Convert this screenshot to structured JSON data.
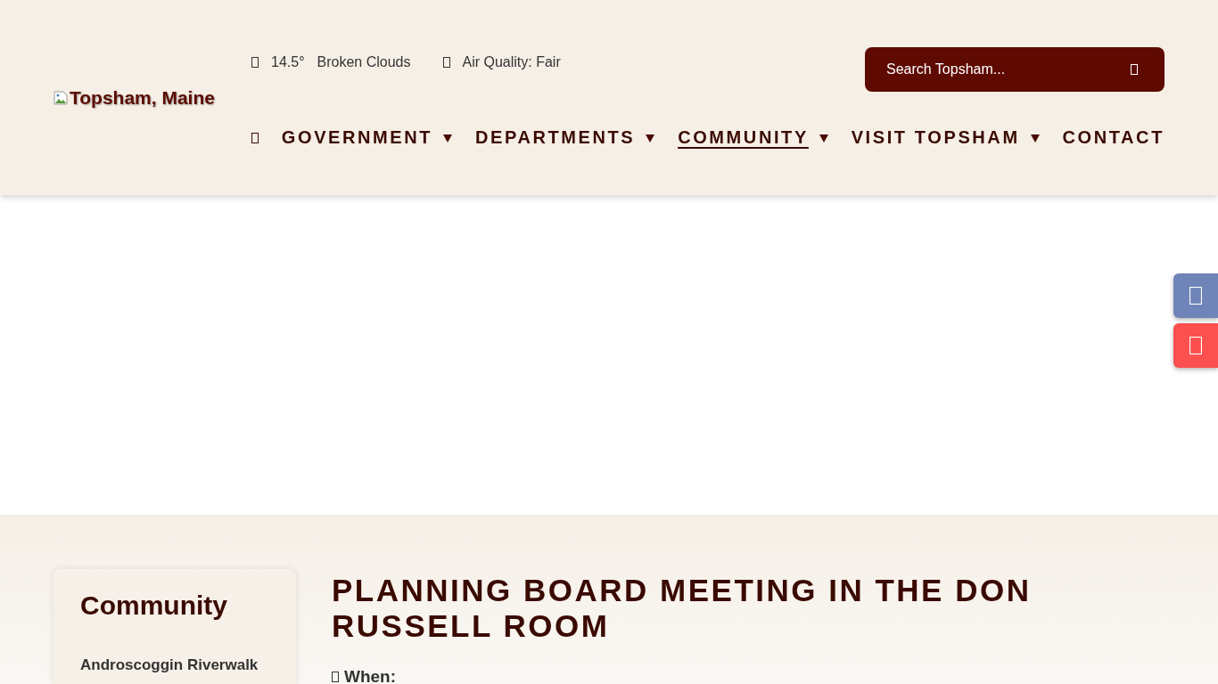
{
  "header": {
    "logo": {
      "alt_text": "Topsham, Maine"
    },
    "weather": {
      "temperature": "14.5°",
      "condition": "Broken Clouds",
      "air_quality": "Air Quality: Fair"
    },
    "search": {
      "placeholder": "Search Topsham..."
    },
    "nav": [
      {
        "kind": "home"
      },
      {
        "kind": "link",
        "label": "GOVERNMENT",
        "has_dropdown": true,
        "selected": false
      },
      {
        "kind": "link",
        "label": "DEPARTMENTS",
        "has_dropdown": true,
        "selected": false
      },
      {
        "kind": "link",
        "label": "COMMUNITY",
        "has_dropdown": true,
        "selected": true
      },
      {
        "kind": "link",
        "label": "VISIT TOPSHAM",
        "has_dropdown": true,
        "selected": false
      },
      {
        "kind": "link",
        "label": "CONTACT",
        "has_dropdown": false,
        "selected": false
      }
    ]
  },
  "side_buttons": [
    {
      "color": "#6f84b8"
    },
    {
      "color": "#fc4f4f"
    }
  ],
  "sidebar": {
    "title": "Community",
    "items": [
      "Androscoggin Riverwalk"
    ]
  },
  "event": {
    "title": "PLANNING BOARD MEETING IN THE DON RUSSELL ROOM",
    "when_label": "When:"
  }
}
